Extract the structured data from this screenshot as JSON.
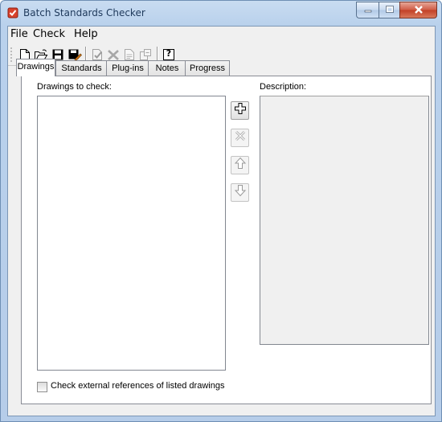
{
  "window": {
    "title": "Batch Standards Checker",
    "accent": "#c23b22"
  },
  "menu": [
    "File",
    "Check",
    "Help"
  ],
  "toolbar": {
    "buttons": [
      "new-icon",
      "open-icon",
      "save-icon",
      "save-as-icon",
      "check-icon",
      "stop-icon",
      "report-icon",
      "export-icon",
      "help-icon"
    ],
    "help_label": "?"
  },
  "tabs": [
    "Drawings",
    "Standards",
    "Plug-ins",
    "Notes",
    "Progress"
  ],
  "active_tab": "Drawings",
  "drawings": {
    "list_label": "Drawings to check:",
    "description_label": "Description:",
    "items": []
  },
  "options": {
    "check_xrefs_label": "Check external references of listed drawings",
    "check_xrefs_checked": false
  }
}
